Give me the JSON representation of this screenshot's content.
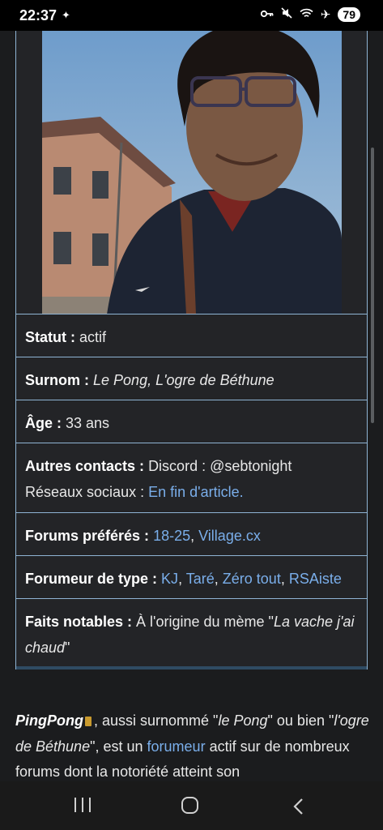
{
  "status_bar": {
    "time": "22:37",
    "battery": "79",
    "icons": [
      "notification-icon",
      "vpn-key-icon",
      "mute-icon",
      "wifi-icon",
      "airplane-icon"
    ]
  },
  "infobox": {
    "photo_alt": "Portrait photo",
    "rows": {
      "statut": {
        "label": "Statut :",
        "value": "actif"
      },
      "surnom": {
        "label": "Surnom :",
        "value": "Le Pong, L'ogre de Béthune"
      },
      "age": {
        "label": "Âge :",
        "value": "33 ans"
      },
      "contacts": {
        "label": "Autres contacts :",
        "discord": "Discord : @sebtonight",
        "reseaux_label": "Réseaux sociaux :",
        "reseaux_link": "En fin d'article."
      },
      "forums": {
        "label": "Forums préférés :",
        "link1": "18-25",
        "sep": ", ",
        "link2": "Village.cx"
      },
      "type": {
        "label": "Forumeur de type :",
        "t1": "KJ",
        "t2": "Taré",
        "t3": "Zéro tout",
        "t4": "RSAiste",
        "sep": ", "
      },
      "faits": {
        "label": "Faits notables :",
        "prefix": "À l'origine du mème \"",
        "quote": "La vache j'ai chaud",
        "suffix": "\""
      }
    }
  },
  "article": {
    "name": "PingPong",
    "text1": ", aussi surnommé \"",
    "nick1": "le Pong",
    "text2": "\" ou bien \"",
    "nick2": "l'ogre de Béthune",
    "text3": "\", est un ",
    "link": "forumeur",
    "text4": " actif sur de nombreux forums dont la notoriété atteint son"
  },
  "colors": {
    "link": "#7aaeea",
    "border": "#8fb4d4",
    "background": "#1b1c1e"
  }
}
